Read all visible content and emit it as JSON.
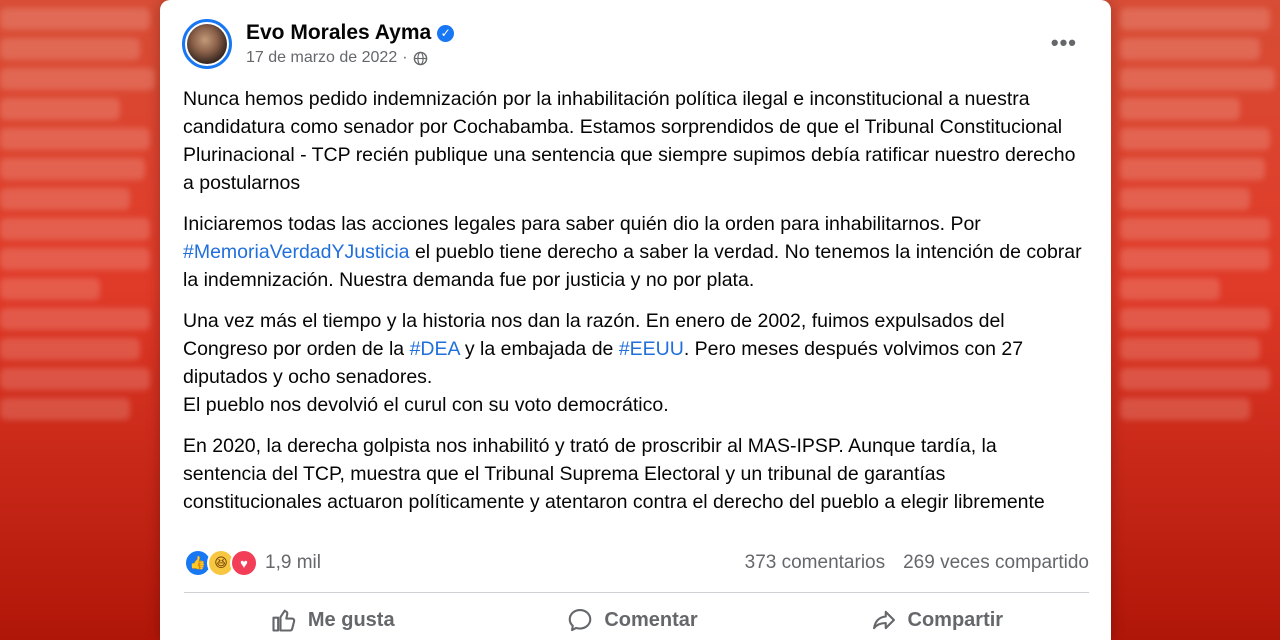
{
  "post": {
    "author": "Evo Morales Ayma",
    "date": "17 de marzo de 2022",
    "separator": "·",
    "more_icon": "more-horizontal-icon",
    "paragraphs": [
      [
        {
          "text": "Nunca hemos pedido indemnización por la inhabilitación política ilegal e inconstitucional a nuestra candidatura como senador por Cochabamba. Estamos sorprendidos de que el Tribunal Constitucional Plurinacional - TCP recién publique una sentencia que siempre supimos debía ratificar nuestro derecho a postularnos"
        }
      ],
      [
        {
          "text": "Iniciaremos todas las acciones legales para saber quién dio la orden para inhabilitarnos. Por "
        },
        {
          "text": "#MemoriaVerdadYJusticia",
          "hashtag": true
        },
        {
          "text": " el pueblo tiene derecho a saber la verdad. No tenemos la intención de cobrar la indemnización. Nuestra demanda fue por justicia y no por plata."
        }
      ],
      [
        {
          "text": "Una vez más el tiempo y la historia nos dan la razón. En enero de 2002, fuimos expulsados del Congreso por orden de la "
        },
        {
          "text": "#DEA",
          "hashtag": true
        },
        {
          "text": " y la embajada de "
        },
        {
          "text": "#EEUU",
          "hashtag": true
        },
        {
          "text": ". Pero meses después volvimos con 27 diputados y ocho senadores."
        },
        {
          "br": true
        },
        {
          "text": "El pueblo nos devolvió el curul con su voto democrático."
        }
      ],
      [
        {
          "text": "En 2020, la derecha golpista nos inhabilitó y trató de proscribir al MAS-IPSP. Aunque tardía, la sentencia del TCP, muestra que el Tribunal Suprema Electoral y un tribunal de garantías constitucionales actuaron políticamente y atentaron contra el derecho del pueblo a elegir libremente"
        }
      ]
    ]
  },
  "stats": {
    "reaction_icons": [
      "like-reaction-icon",
      "haha-reaction-icon",
      "love-reaction-icon"
    ],
    "reactions": "1,9 mil",
    "comments": "373 comentarios",
    "shares": "269 veces compartido"
  },
  "actions": {
    "like": "Me gusta",
    "comment": "Comentar",
    "share": "Compartir"
  },
  "colors": {
    "accent": "#1877f2",
    "hashtag": "#216fdb",
    "secondary_text": "#65676b",
    "background": "#e03a28"
  }
}
